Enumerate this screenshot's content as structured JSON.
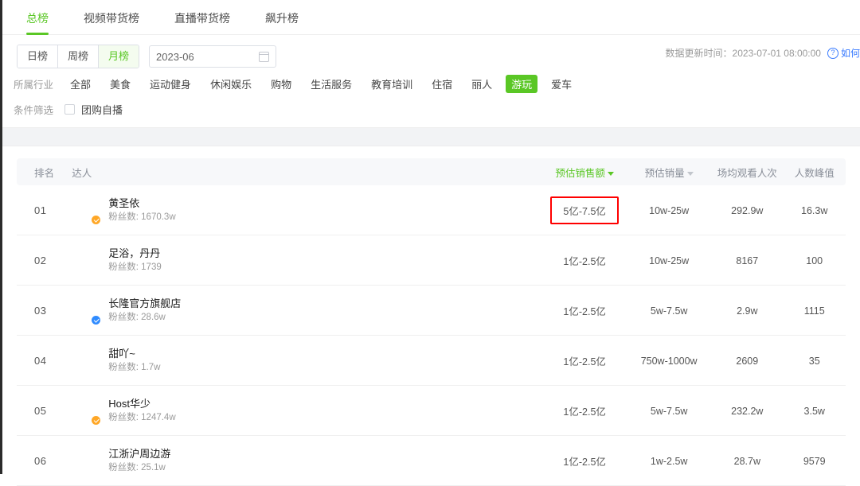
{
  "tabs": [
    {
      "label": "总榜",
      "active": true
    },
    {
      "label": "视频带货榜",
      "active": false
    },
    {
      "label": "直播带货榜",
      "active": false
    },
    {
      "label": "飙升榜",
      "active": false
    }
  ],
  "period": {
    "buttons": [
      {
        "label": "日榜",
        "active": false
      },
      {
        "label": "周榜",
        "active": false
      },
      {
        "label": "月榜",
        "active": true
      }
    ],
    "date_value": "2023-06",
    "calendar_icon": "calendar-icon"
  },
  "update_info": {
    "label": "数据更新时间：",
    "time": "2023-07-01 08:00:00",
    "help_icon": "question-circle-icon",
    "help_link": "如何"
  },
  "filters": {
    "industry_label": "所属行业",
    "industries": [
      {
        "label": "全部",
        "active": false
      },
      {
        "label": "美食",
        "active": false
      },
      {
        "label": "运动健身",
        "active": false
      },
      {
        "label": "休闲娱乐",
        "active": false
      },
      {
        "label": "购物",
        "active": false
      },
      {
        "label": "生活服务",
        "active": false
      },
      {
        "label": "教育培训",
        "active": false
      },
      {
        "label": "住宿",
        "active": false
      },
      {
        "label": "丽人",
        "active": false
      },
      {
        "label": "游玩",
        "active": true
      },
      {
        "label": "爱车",
        "active": false
      }
    ],
    "condition_label": "条件筛选",
    "condition_checkbox": {
      "label": "团购自播",
      "checked": false
    }
  },
  "table": {
    "headers": {
      "rank": "排名",
      "talent": "达人",
      "sales": "预估销售额",
      "volume": "预估销量",
      "views": "场均观看人次",
      "peak": "人数峰值"
    },
    "sort_active_column": "预估销售额",
    "rows": [
      {
        "rank": "01",
        "name": "黄圣依",
        "fans": "粉丝数: 1670.3w",
        "badge": "orange",
        "avatar_colors": [
          "#3f7d46",
          "#d9e4d4"
        ],
        "sales": "5亿-7.5亿",
        "sales_highlighted": true,
        "volume": "10w-25w",
        "views": "292.9w",
        "peak": "16.3w"
      },
      {
        "rank": "02",
        "name": "足浴，丹丹",
        "fans": "粉丝数: 1739",
        "badge": "none",
        "avatar_colors": [
          "#2f6fb5",
          "#a8cbe8"
        ],
        "sales": "1亿-2.5亿",
        "sales_highlighted": false,
        "volume": "10w-25w",
        "views": "8167",
        "peak": "100"
      },
      {
        "rank": "03",
        "name": "长隆官方旗舰店",
        "fans": "粉丝数: 28.6w",
        "badge": "blue",
        "avatar_colors": [
          "#1d4f3c",
          "#d7e8c8"
        ],
        "sales": "1亿-2.5亿",
        "sales_highlighted": false,
        "volume": "5w-7.5w",
        "views": "2.9w",
        "peak": "1115"
      },
      {
        "rank": "04",
        "name": "甜吖~",
        "fans": "粉丝数: 1.7w",
        "badge": "none",
        "avatar_colors": [
          "#6b4b3a",
          "#e8d9c8"
        ],
        "sales": "1亿-2.5亿",
        "sales_highlighted": false,
        "volume": "750w-1000w",
        "views": "2609",
        "peak": "35"
      },
      {
        "rank": "05",
        "name": "Host华少",
        "fans": "粉丝数: 1247.4w",
        "badge": "orange",
        "avatar_colors": [
          "#2f6fb5",
          "#dbe7f2"
        ],
        "sales": "1亿-2.5亿",
        "sales_highlighted": false,
        "volume": "5w-7.5w",
        "views": "232.2w",
        "peak": "3.5w"
      },
      {
        "rank": "06",
        "name": "江浙沪周边游",
        "fans": "粉丝数: 25.1w",
        "badge": "none",
        "avatar_colors": [
          "#2f8bff",
          "#9fc8ff"
        ],
        "sales": "1亿-2.5亿",
        "sales_highlighted": false,
        "volume": "1w-2.5w",
        "views": "28.7w",
        "peak": "9579"
      }
    ]
  },
  "colors": {
    "accent_green": "#5ac725",
    "link_blue": "#3b7cff",
    "highlight_red": "#ff0000"
  }
}
